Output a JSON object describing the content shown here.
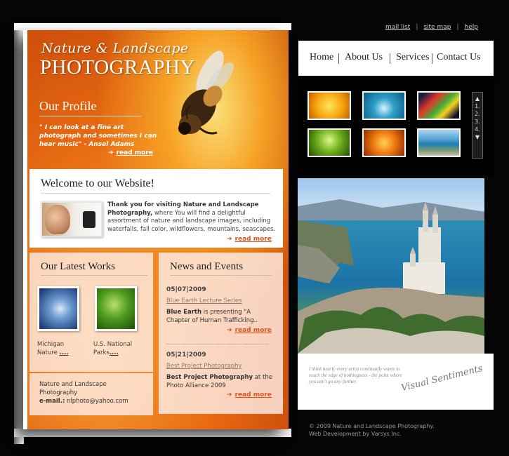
{
  "top_links": [
    "mail list",
    "site map",
    "help"
  ],
  "brand": {
    "line1": "Nature & Landscape",
    "line2": "PHOTOGRAPHY"
  },
  "profile": {
    "heading": "Our Profile",
    "quote": "\" I can look at a fine art photograph and sometimes I can hear music\" - Ansel Adams",
    "more": "read more"
  },
  "welcome": {
    "heading": "Welcome to our Website!",
    "intro_bold": "Thank you for visiting Nature and Landscape Photography,",
    "intro_rest": " where You will find a delightful assortment of nature and landscape images, including waterfalls, fall color, wildflowers, mountains, seascapes.",
    "more": "read more"
  },
  "works": {
    "heading": "Our Latest Works",
    "items": [
      {
        "line1": "Michigan",
        "line2": "Nature ",
        "dots": "...."
      },
      {
        "line1": "U.S. National",
        "line2": "Parks",
        "dots": "...."
      }
    ]
  },
  "contact": {
    "line1": "Nature and Landscape",
    "line2": "Photography",
    "email_label": "e-mail.:",
    "email": " nlphoto@yahoo.com"
  },
  "news": {
    "heading": "News and Events",
    "items": [
      {
        "date": "05|07|2009",
        "title": "Blue Earth Lecture Series",
        "bold": "Blue Earth",
        "text": " is presenting \"A Chapter of Human Trafficking..",
        "more": "read more"
      },
      {
        "date": "05|21|2009",
        "title": "Best Project Photography",
        "bold": "Best Project Photography",
        "text": " at the Photo Alliance 2009",
        "more": "read more"
      }
    ]
  },
  "nav": {
    "items": [
      "Home",
      "About Us",
      "Services",
      "Contact Us"
    ]
  },
  "gallery": {
    "pager": [
      "1.",
      "2.",
      "3.",
      "4."
    ]
  },
  "sentiment": {
    "quote": "I think nearly every artist continually wants to reach the edge of nothingness - the point where you can't go any further.",
    "signature": "Visual Sentiments"
  },
  "footer": {
    "line1": "© 2009 Nature and Landscape Photography.",
    "line2": "Web Development by Varsys Inc."
  },
  "colors": {
    "accent": "#e0551b",
    "panel_orange": "#e8731a",
    "background": "#050505"
  }
}
